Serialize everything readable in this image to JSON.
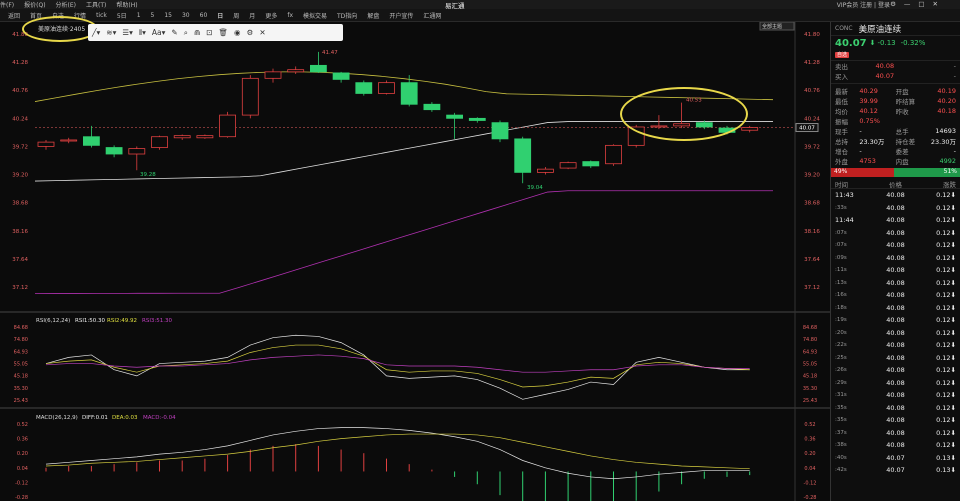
{
  "menubar": {
    "items": [
      "件(F)",
      "报价(Q)",
      "分析(E)",
      "工具(T)",
      "帮助(H)"
    ],
    "app_title": "易汇通",
    "user_links": "VIP会员 注册 | 登录"
  },
  "toolbar": {
    "items": [
      "返回",
      "首页",
      "自选",
      "行情",
      "tick",
      "5日",
      "1",
      "5",
      "15",
      "30",
      "60",
      "日",
      "周",
      "月",
      "更多",
      "fx",
      "模拟交易",
      "TD指向",
      "解盘",
      "开户宣传",
      "汇通网"
    ]
  },
  "chart": {
    "title": "美原油连续",
    "title_suffix": "·2405",
    "price_labels": [
      "41.80",
      "41.28",
      "40.76",
      "40.24",
      "39.72",
      "39.20",
      "38.68",
      "38.16",
      "37.64",
      "37.12"
    ],
    "theme_btn": "全部主题",
    "current_price_tag": "40.07",
    "annotations": {
      "high1": "41.47",
      "low1": "39.28",
      "low2": "39.04",
      "high2": "40.53"
    },
    "candles": [
      {
        "o": 39.72,
        "c": 39.8,
        "h": 39.84,
        "l": 39.66
      },
      {
        "o": 39.82,
        "c": 39.84,
        "h": 39.88,
        "l": 39.78
      },
      {
        "o": 39.9,
        "c": 39.74,
        "h": 40.1,
        "l": 39.7
      },
      {
        "o": 39.7,
        "c": 39.58,
        "h": 39.74,
        "l": 39.52
      },
      {
        "o": 39.58,
        "c": 39.68,
        "h": 39.72,
        "l": 39.28
      },
      {
        "o": 39.7,
        "c": 39.9,
        "h": 39.92,
        "l": 39.66
      },
      {
        "o": 39.88,
        "c": 39.92,
        "h": 39.94,
        "l": 39.84
      },
      {
        "o": 39.88,
        "c": 39.92,
        "h": 39.94,
        "l": 39.86
      },
      {
        "o": 39.9,
        "c": 40.3,
        "h": 40.36,
        "l": 39.88
      },
      {
        "o": 40.3,
        "c": 40.98,
        "h": 41.04,
        "l": 40.24
      },
      {
        "o": 40.98,
        "c": 41.1,
        "h": 41.16,
        "l": 40.9
      },
      {
        "o": 41.1,
        "c": 41.14,
        "h": 41.2,
        "l": 41.06
      },
      {
        "o": 41.22,
        "c": 41.1,
        "h": 41.47,
        "l": 41.08
      },
      {
        "o": 41.08,
        "c": 40.96,
        "h": 41.1,
        "l": 40.9
      },
      {
        "o": 40.9,
        "c": 40.7,
        "h": 40.94,
        "l": 40.66
      },
      {
        "o": 40.7,
        "c": 40.9,
        "h": 40.94,
        "l": 40.68
      },
      {
        "o": 40.9,
        "c": 40.5,
        "h": 41.04,
        "l": 40.46
      },
      {
        "o": 40.5,
        "c": 40.4,
        "h": 40.54,
        "l": 40.36
      },
      {
        "o": 40.3,
        "c": 40.24,
        "h": 40.34,
        "l": 39.86
      },
      {
        "o": 40.24,
        "c": 40.2,
        "h": 40.26,
        "l": 40.16
      },
      {
        "o": 40.16,
        "c": 39.86,
        "h": 40.2,
        "l": 39.8
      },
      {
        "o": 39.86,
        "c": 39.24,
        "h": 39.9,
        "l": 39.04
      },
      {
        "o": 39.24,
        "c": 39.3,
        "h": 39.34,
        "l": 39.2
      },
      {
        "o": 39.32,
        "c": 39.42,
        "h": 39.44,
        "l": 39.3
      },
      {
        "o": 39.44,
        "c": 39.36,
        "h": 39.46,
        "l": 39.32
      },
      {
        "o": 39.4,
        "c": 39.74,
        "h": 39.76,
        "l": 39.36
      },
      {
        "o": 39.74,
        "c": 40.08,
        "h": 40.12,
        "l": 39.7
      },
      {
        "o": 40.08,
        "c": 40.1,
        "h": 40.3,
        "l": 40.04
      },
      {
        "o": 40.1,
        "c": 40.14,
        "h": 40.53,
        "l": 40.06
      },
      {
        "o": 40.16,
        "c": 40.08,
        "h": 40.2,
        "l": 40.04
      },
      {
        "o": 40.06,
        "c": 39.98,
        "h": 40.1,
        "l": 39.94
      },
      {
        "o": 40.02,
        "c": 40.07,
        "h": 40.1,
        "l": 39.98
      }
    ]
  },
  "rsi": {
    "label": "RSI(6,12,24)",
    "rsi1": "RSI1:50.30",
    "rsi2": "RSI2:49.92",
    "rsi3": "RSI3:51.30",
    "levels": [
      "84.68",
      "74.80",
      "64.93",
      "55.05",
      "45.18",
      "35.30",
      "25.43"
    ]
  },
  "macd": {
    "label": "MACD(26,12,9)",
    "diff": "DIFF:0.01",
    "dea": "DEA:0.03",
    "macd": "MACD:-0.04",
    "levels": [
      "0.52",
      "0.36",
      "0.20",
      "0.04",
      "-0.12",
      "-0.28"
    ]
  },
  "panel": {
    "code": "CONC",
    "name": "美原油连续",
    "price": "40.07",
    "change": "-0.13",
    "change_pct": "-0.32%",
    "badge": "自选",
    "bid_label": "卖出",
    "bid": "40.08",
    "bid_vol": "-",
    "ask_label": "买入",
    "ask": "40.07",
    "ask_vol": "-",
    "stats": [
      [
        "最新",
        "40.29",
        "开盘",
        "40.19"
      ],
      [
        "最低",
        "39.99",
        "昨结算",
        "40.20"
      ],
      [
        "均价",
        "40.12",
        "昨收",
        "40.18"
      ],
      [
        "振幅",
        "0.75%",
        "",
        ""
      ],
      [
        "现手",
        "-",
        "总手",
        "14693"
      ],
      [
        "总持",
        "23.30万",
        "持仓差",
        "23.30万"
      ],
      [
        "增仓",
        "-",
        "委差",
        "-"
      ],
      [
        "外盘",
        "4753",
        "内盘",
        "4992"
      ]
    ],
    "ratio_left": "49%",
    "ratio_right": "51%",
    "ticks_header": [
      "时间",
      "价格",
      "涨跌"
    ],
    "ticks": [
      [
        "11:43",
        "40.08",
        "0.12"
      ],
      [
        ":33s",
        "40.08",
        "0.12"
      ],
      [
        "11:44",
        "40.08",
        "0.12"
      ],
      [
        ":07s",
        "40.08",
        "0.12"
      ],
      [
        ":07s",
        "40.08",
        "0.12"
      ],
      [
        ":09s",
        "40.08",
        "0.12"
      ],
      [
        ":11s",
        "40.08",
        "0.12"
      ],
      [
        ":13s",
        "40.08",
        "0.12"
      ],
      [
        ":16s",
        "40.08",
        "0.12"
      ],
      [
        ":18s",
        "40.08",
        "0.12"
      ],
      [
        ":19s",
        "40.08",
        "0.12"
      ],
      [
        ":20s",
        "40.08",
        "0.12"
      ],
      [
        ":22s",
        "40.08",
        "0.12"
      ],
      [
        ":25s",
        "40.08",
        "0.12"
      ],
      [
        ":26s",
        "40.08",
        "0.12"
      ],
      [
        ":29s",
        "40.08",
        "0.12"
      ],
      [
        ":31s",
        "40.08",
        "0.12"
      ],
      [
        ":35s",
        "40.08",
        "0.12"
      ],
      [
        ":35s",
        "40.08",
        "0.12"
      ],
      [
        ":37s",
        "40.08",
        "0.12"
      ],
      [
        ":38s",
        "40.08",
        "0.12"
      ],
      [
        ":40s",
        "40.07",
        "0.13"
      ],
      [
        ":42s",
        "40.07",
        "0.13"
      ]
    ]
  }
}
